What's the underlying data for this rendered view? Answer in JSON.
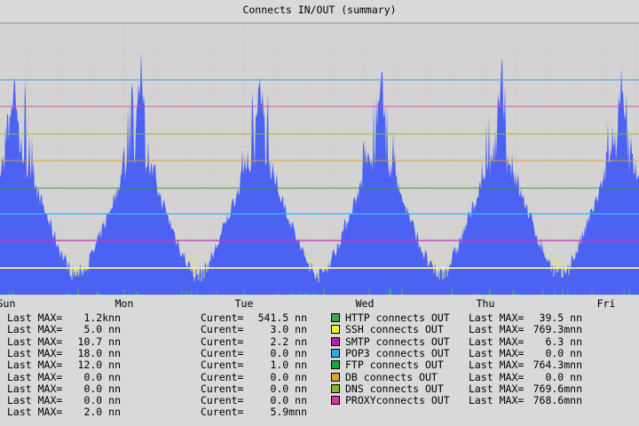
{
  "chart_data": {
    "type": "area",
    "title": "Connects IN/OUT (summary)",
    "x_ticks": [
      "Sun",
      "Mon",
      "Tue",
      "Wed",
      "Thu",
      "Fri"
    ],
    "y_range": [
      0,
      1.0
    ],
    "grid": true,
    "colors": {
      "background": "#d3d3d3",
      "area": "#4b62f2",
      "grid": "#e8a0a0",
      "level_lines": [
        "#f0e68c",
        "#c040c0",
        "#30b0f0",
        "#30b030",
        "#e0a030",
        "#90c030",
        "#e040a0"
      ]
    },
    "series": [
      {
        "name": "HTTP connects OUT",
        "color": "#30b040"
      },
      {
        "name": "SSH connects OUT",
        "color": "#f0f030"
      },
      {
        "name": "SMTP connects OUT",
        "color": "#b020b0"
      },
      {
        "name": "POP3 connects OUT",
        "color": "#30a8f0"
      },
      {
        "name": "FTP connects OUT",
        "color": "#20a040"
      },
      {
        "name": "DB connects OUT",
        "color": "#e0a030"
      },
      {
        "name": "DNS connects OUT",
        "color": "#90b030"
      },
      {
        "name": "PROXYconnects OUT",
        "color": "#e030a0"
      }
    ]
  },
  "stats": {
    "left_max": [
      {
        "label": "Last MAX=",
        "value": "1.2knn"
      },
      {
        "label": "Last MAX=",
        "value": "5.0 nn"
      },
      {
        "label": "Last MAX=",
        "value": "10.7 nn"
      },
      {
        "label": "Last MAX=",
        "value": "18.0 nn"
      },
      {
        "label": "Last MAX=",
        "value": "12.0 nn"
      },
      {
        "label": "Last MAX=",
        "value": "0.0 nn"
      },
      {
        "label": "Last MAX=",
        "value": "0.0 nn"
      },
      {
        "label": "Last MAX=",
        "value": "0.0 nn"
      },
      {
        "label": "Last MAX=",
        "value": "2.0 nn"
      }
    ],
    "current": [
      {
        "label": "Curent=",
        "value": "541.5 nn"
      },
      {
        "label": "Curent=",
        "value": "3.0 nn"
      },
      {
        "label": "Curent=",
        "value": "2.2 nn"
      },
      {
        "label": "Curent=",
        "value": "0.0 nn"
      },
      {
        "label": "Curent=",
        "value": "1.0 nn"
      },
      {
        "label": "Curent=",
        "value": "0.0 nn"
      },
      {
        "label": "Curent=",
        "value": "0.0 nn"
      },
      {
        "label": "Curent=",
        "value": "0.0 nn"
      },
      {
        "label": "Curent=",
        "value": "5.9mnn"
      }
    ],
    "right_max": [
      {
        "label": "Last MAX=",
        "value": "39.5 nn"
      },
      {
        "label": "Last MAX=",
        "value": "769.3mnn"
      },
      {
        "label": "Last MAX=",
        "value": "6.3 nn"
      },
      {
        "label": "Last MAX=",
        "value": "0.0 nn"
      },
      {
        "label": "Last MAX=",
        "value": "764.3mnn"
      },
      {
        "label": "Last MAX=",
        "value": "0.0 nn"
      },
      {
        "label": "Last MAX=",
        "value": "769.6mnn"
      },
      {
        "label": "Last MAX=",
        "value": "768.6mnn"
      }
    ]
  }
}
